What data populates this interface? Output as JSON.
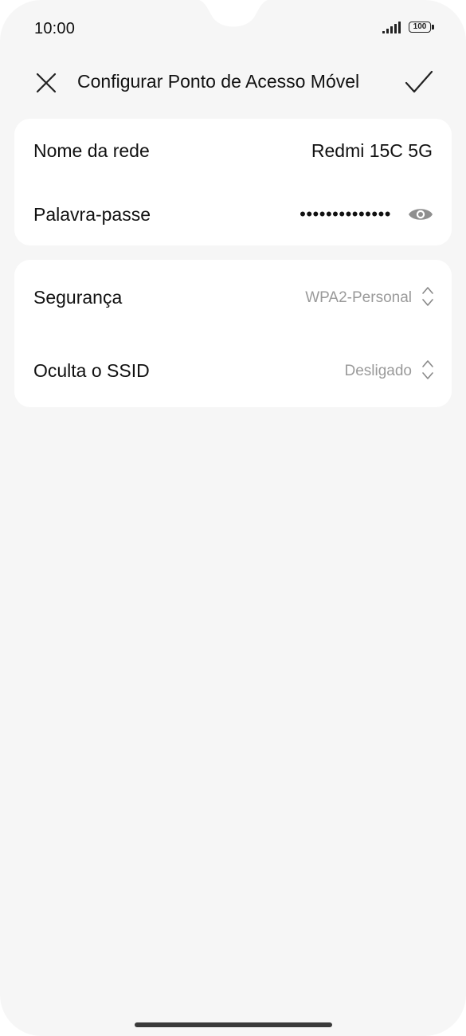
{
  "status_bar": {
    "time": "10:00",
    "battery": "100"
  },
  "header": {
    "title": "Configurar Ponto de Acesso Móvel"
  },
  "network_card": {
    "name_label": "Nome da rede",
    "name_value": "Redmi 15C 5G",
    "password_label": "Palavra-passe",
    "password_value": "••••••••••••••"
  },
  "security_card": {
    "security_label": "Segurança",
    "security_value": "WPA2-Personal",
    "hidden_ssid_label": "Oculta o SSID",
    "hidden_ssid_value": "Desligado"
  },
  "icons": {
    "close": "close-icon",
    "confirm": "check-icon",
    "eye": "eye-icon",
    "updown": "chevron-updown-icon",
    "signal": "signal-icon",
    "battery": "battery-icon"
  },
  "colors": {
    "background": "#f6f6f6",
    "card": "#ffffff",
    "text_primary": "#111111",
    "text_secondary": "#9a9a9a"
  }
}
